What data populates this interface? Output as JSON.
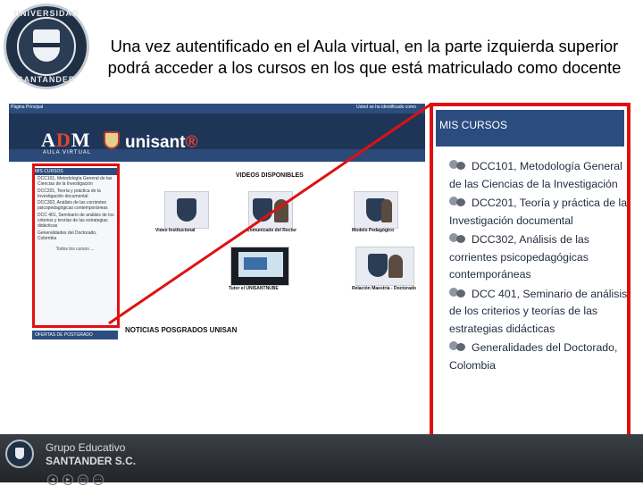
{
  "slide": {
    "title": "Una vez autentificado en el Aula virtual, en la parte izquierda superior podrá acceder a los cursos en los que está matriculado como docente"
  },
  "seal": {
    "top_text": "UNIVERSIDAD",
    "bottom_text": "SANTANDER"
  },
  "mini_screenshot": {
    "topbar_left": "Página Principal",
    "topbar_right": "Usted se ha identificado como",
    "logo_main_a": "A",
    "logo_main_d": "D",
    "logo_main_m": "M",
    "logo_sub": "AULA VIRTUAL",
    "logo_brand": "unisant",
    "logo_mark": "®",
    "my_courses_header": "MIS CURSOS",
    "courses": [
      "DCC101, Metodología General de las Ciencias de la Investigación",
      "DCC201, Teoría y práctica de la Investigación documental",
      "DCC302, Análisis de las corrientes psicopedagógicas contemporáneas",
      "DCC 401, Seminario de análisis de los criterios y teorías de las estrategias didácticas",
      "Generalidades del Doctorado, Colombia"
    ],
    "all_courses": "Todos los cursos ...",
    "panel2_header": "OFERTAS DE POSTGRADO",
    "videos_title": "VIDEOS DISPONIBLES",
    "videos": [
      "Video Institucional",
      "Comunicado del Rector",
      "Modelo Pedagógico",
      "Tutor el UNISANTNUBE",
      "Relación Maestría - Doctorado"
    ],
    "news_title": "NOTICIAS POSGRADOS UNISAN"
  },
  "zoom_panel": {
    "header": "MIS CURSOS",
    "courses": [
      "DCC101, Metodología General de las Ciencias de la Investigación",
      "DCC201, Teoría y práctica de la Investigación documental",
      "DCC302, Análisis de las corrientes psicopedagógicas contemporáneas",
      "DCC 401, Seminario de análisis de los criterios y teorías de las estrategias didácticas",
      "Generalidades del Doctorado, Colombia"
    ]
  },
  "footer": {
    "line1": "Grupo Educativo",
    "line2": "SANTANDER S.C.",
    "nav": [
      "◂",
      "▸",
      "▭",
      "⋯"
    ]
  },
  "colors": {
    "accent_red": "#e01010",
    "navy": "#2b4c7e"
  }
}
